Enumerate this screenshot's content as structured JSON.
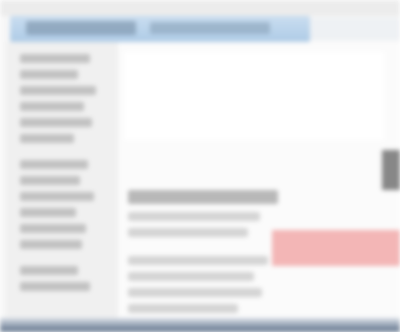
{
  "window": {
    "title": ""
  },
  "colors": {
    "title_bar": "#aecbe6",
    "highlight": "#f3b6b6",
    "taskbar": "#5c6f88"
  }
}
